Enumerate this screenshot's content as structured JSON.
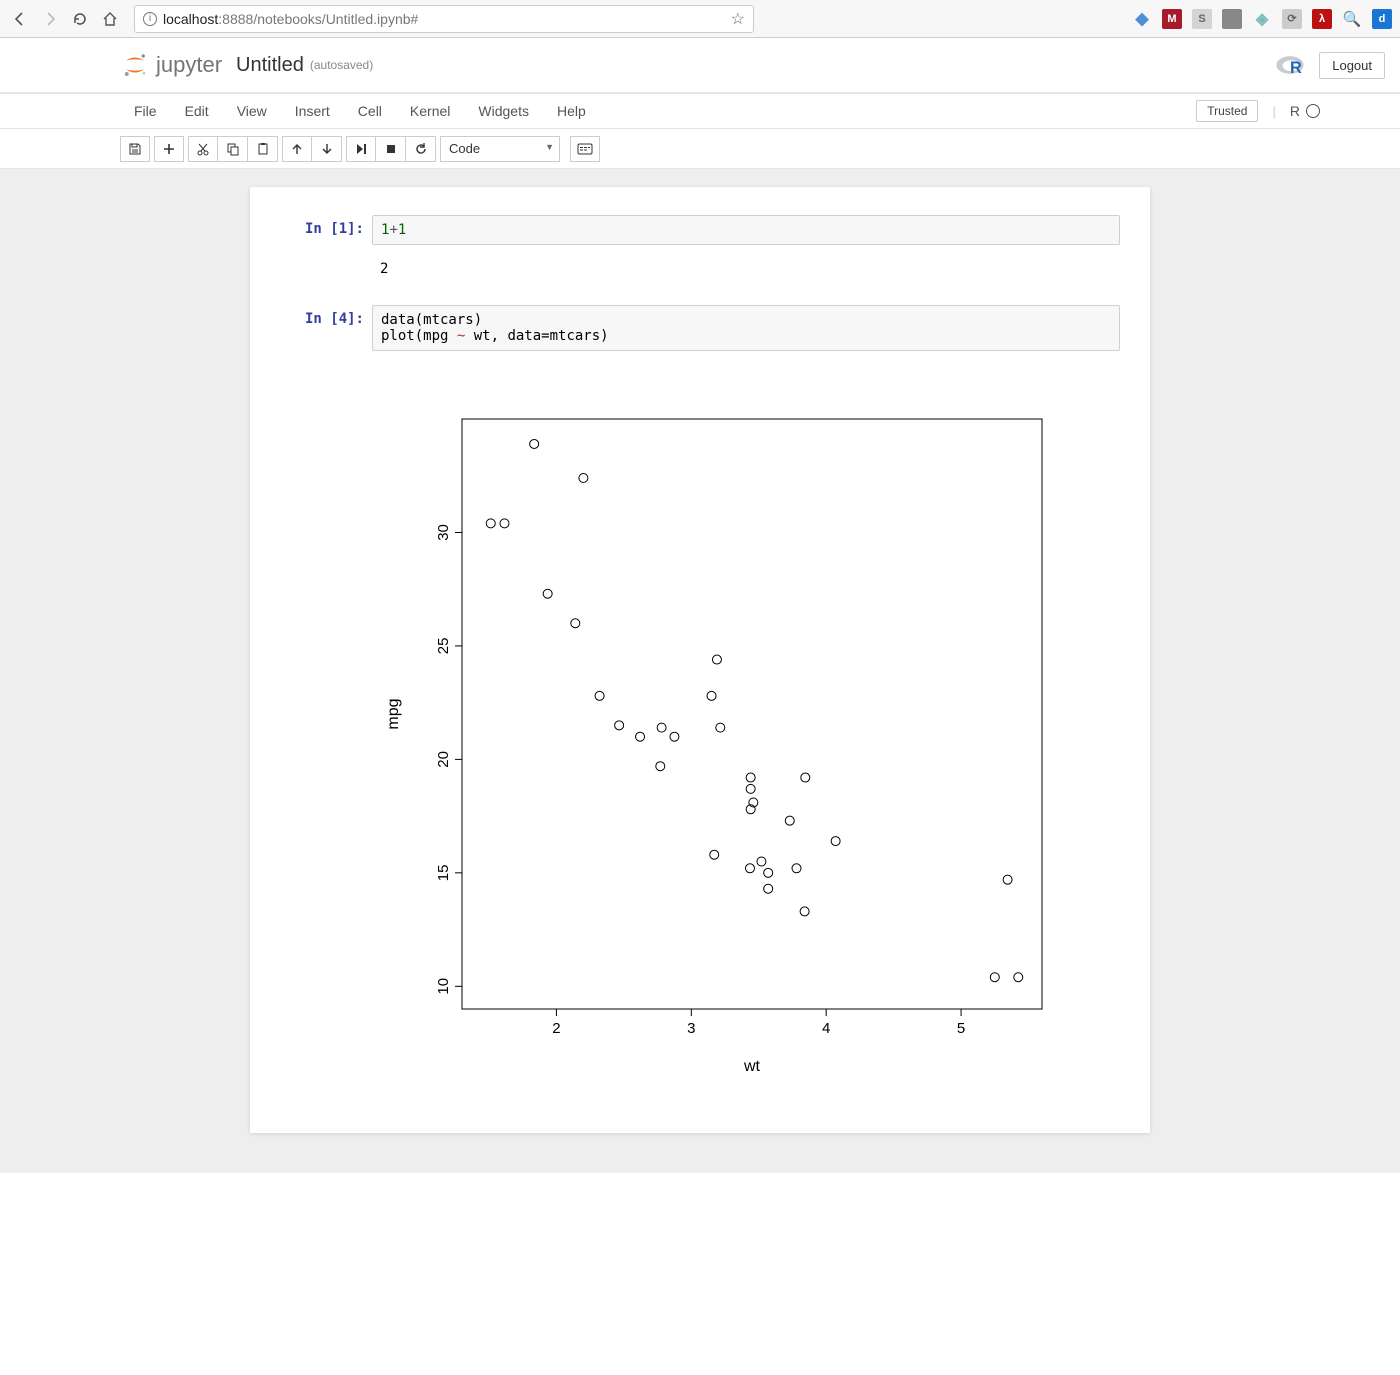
{
  "browser": {
    "url_host": "localhost",
    "url_port": ":8888",
    "url_path": "/notebooks/Untitled.ipynb#"
  },
  "header": {
    "brand": "jupyter",
    "title": "Untitled",
    "autosave": "(autosaved)",
    "logout": "Logout"
  },
  "menus": [
    "File",
    "Edit",
    "View",
    "Insert",
    "Cell",
    "Kernel",
    "Widgets",
    "Help"
  ],
  "trusted": "Trusted",
  "kernel_name": "R",
  "celltype": "Code",
  "cells": [
    {
      "prompt": "In [1]:",
      "code_html": "<span class='tok-num'>1</span><span class='tok-op'>+</span><span class='tok-num'>1</span>",
      "output": "2"
    },
    {
      "prompt": "In [4]:",
      "code_html": "data(mtcars)\nplot(mpg <span class='tok-kw'>~</span> wt, data=mtcars)",
      "output": null
    }
  ],
  "chart_data": {
    "type": "scatter",
    "xlabel": "wt",
    "ylabel": "mpg",
    "xlim": [
      1.3,
      5.6
    ],
    "ylim": [
      9,
      35
    ],
    "x_ticks": [
      2,
      3,
      4,
      5
    ],
    "y_ticks": [
      10,
      15,
      20,
      25,
      30
    ],
    "points": [
      {
        "wt": 2.62,
        "mpg": 21.0
      },
      {
        "wt": 2.875,
        "mpg": 21.0
      },
      {
        "wt": 2.32,
        "mpg": 22.8
      },
      {
        "wt": 3.215,
        "mpg": 21.4
      },
      {
        "wt": 3.44,
        "mpg": 18.7
      },
      {
        "wt": 3.46,
        "mpg": 18.1
      },
      {
        "wt": 3.57,
        "mpg": 14.3
      },
      {
        "wt": 3.19,
        "mpg": 24.4
      },
      {
        "wt": 3.15,
        "mpg": 22.8
      },
      {
        "wt": 3.44,
        "mpg": 19.2
      },
      {
        "wt": 3.44,
        "mpg": 17.8
      },
      {
        "wt": 4.07,
        "mpg": 16.4
      },
      {
        "wt": 3.73,
        "mpg": 17.3
      },
      {
        "wt": 3.78,
        "mpg": 15.2
      },
      {
        "wt": 5.25,
        "mpg": 10.4
      },
      {
        "wt": 5.424,
        "mpg": 10.4
      },
      {
        "wt": 5.345,
        "mpg": 14.7
      },
      {
        "wt": 2.2,
        "mpg": 32.4
      },
      {
        "wt": 1.615,
        "mpg": 30.4
      },
      {
        "wt": 1.835,
        "mpg": 33.9
      },
      {
        "wt": 2.465,
        "mpg": 21.5
      },
      {
        "wt": 3.52,
        "mpg": 15.5
      },
      {
        "wt": 3.435,
        "mpg": 15.2
      },
      {
        "wt": 3.84,
        "mpg": 13.3
      },
      {
        "wt": 3.845,
        "mpg": 19.2
      },
      {
        "wt": 1.935,
        "mpg": 27.3
      },
      {
        "wt": 2.14,
        "mpg": 26.0
      },
      {
        "wt": 1.513,
        "mpg": 30.4
      },
      {
        "wt": 3.17,
        "mpg": 15.8
      },
      {
        "wt": 2.77,
        "mpg": 19.7
      },
      {
        "wt": 3.57,
        "mpg": 15.0
      },
      {
        "wt": 2.78,
        "mpg": 21.4
      }
    ]
  }
}
